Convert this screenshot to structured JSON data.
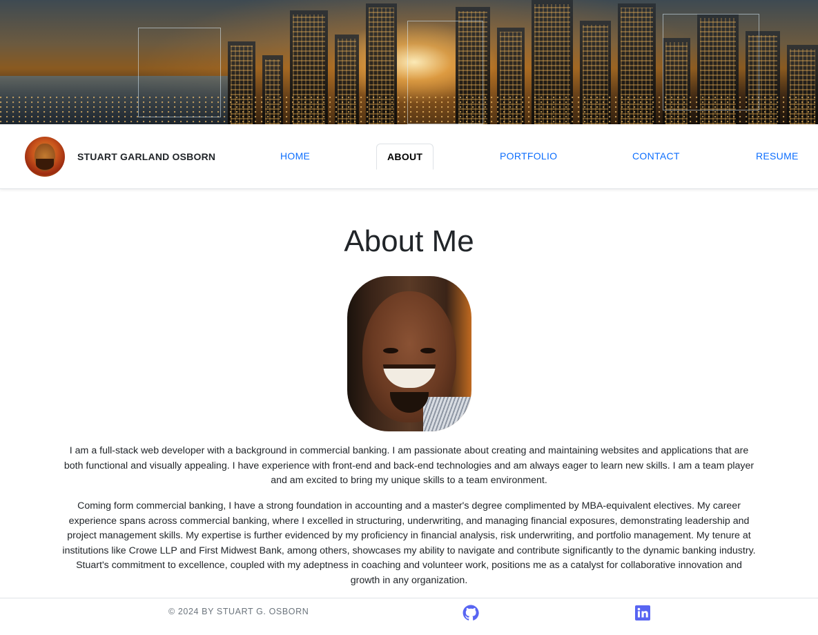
{
  "navbar": {
    "brand_name": "STUART GARLAND OSBORN",
    "links": [
      {
        "label": "HOME",
        "active": false
      },
      {
        "label": "ABOUT",
        "active": true
      },
      {
        "label": "PORTFOLIO",
        "active": false
      },
      {
        "label": "CONTACT",
        "active": false
      },
      {
        "label": "RESUME",
        "active": false
      }
    ]
  },
  "main": {
    "title": "About Me",
    "paragraphs": [
      "I am a full-stack web developer with a background in commercial banking. I am passionate about creating and maintaining websites and applications that are both functional and visually appealing. I have experience with front-end and back-end technologies and am always eager to learn new skills. I am a team player and am excited to bring my unique skills to a team environment.",
      "Coming form commercial banking, I have a strong foundation in accounting and a master's degree complimented by MBA-equivalent electives. My career experience spans across commercial banking, where I excelled in structuring, underwriting, and managing financial exposures, demonstrating leadership and project management skills. My expertise is further evidenced by my proficiency in financial analysis, risk underwriting, and portfolio management. My tenure at institutions like Crowe LLP and First Midwest Bank, among others, showcases my ability to navigate and contribute significantly to the dynamic banking industry. Stuart's commitment to excellence, coupled with my adeptness in coaching and volunteer work, positions me as a catalyst for collaborative innovation and growth in any organization."
    ]
  },
  "footer": {
    "copyright": "© 2024 BY STUART G. OSBORN",
    "social": [
      {
        "icon": "github-icon",
        "color": "#5865f2"
      },
      {
        "icon": "linkedin-icon",
        "color": "#5865f2"
      }
    ]
  },
  "colors": {
    "link": "#0d6efd",
    "text": "#212529",
    "muted": "#6c757d",
    "icon_accent": "#5865f2"
  }
}
